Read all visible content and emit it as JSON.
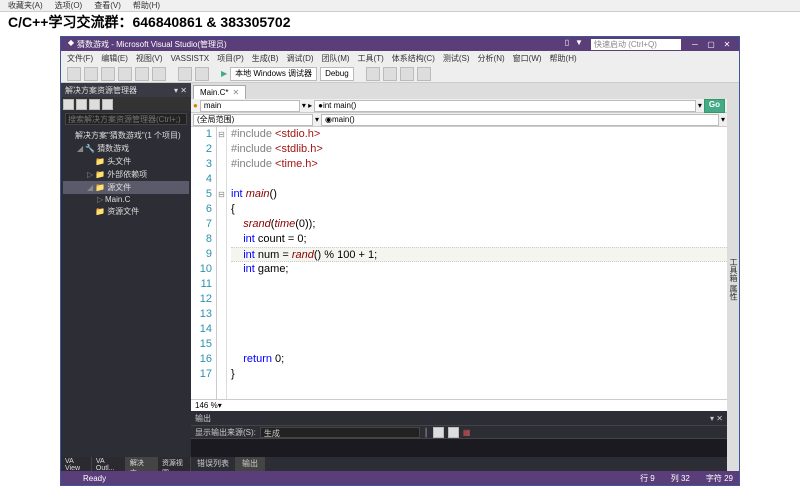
{
  "browser_menu": [
    "收藏夹(A)",
    "选项(O)",
    "查看(V)",
    "帮助(H)"
  ],
  "banner": "C/C++学习交流群：646840861 & 383305702",
  "title": "猜数游戏 - Microsoft Visual Studio(管理员)",
  "quick_launch": "快速启动 (Ctrl+Q)",
  "main_menu": [
    "文件(F)",
    "编辑(E)",
    "视图(V)",
    "VASSISTX",
    "项目(P)",
    "生成(B)",
    "调试(D)",
    "团队(M)",
    "工具(T)",
    "体系结构(C)",
    "测试(S)",
    "分析(N)",
    "窗口(W)",
    "帮助(H)"
  ],
  "toolbar": {
    "debugger": "本地 Windows 调试器",
    "config": "Debug"
  },
  "solution_panel": {
    "title": "解决方案资源管理器",
    "search_ph": "搜索解决方案资源管理器(Ctrl+;)",
    "root": "解决方案\"猜数游戏\"(1 个项目)",
    "project": "猜数游戏",
    "folders": [
      "头文件",
      "外部依赖项",
      "源文件",
      "资源文件"
    ],
    "file": "Main.C",
    "bottom_tabs": [
      "VA View",
      "VA Outl...",
      "解决方...",
      "资源视图"
    ]
  },
  "editor": {
    "tab": "Main.C*",
    "nav_l": "main",
    "nav_r": "int main()",
    "nav_b": "main()",
    "scope": "(全局范围)",
    "zoom": "146 %",
    "go": "Go",
    "lines": [
      {
        "n": 1,
        "seg": [
          [
            "pp",
            "#include "
          ],
          [
            "inc",
            "<stdio.h>"
          ]
        ]
      },
      {
        "n": 2,
        "seg": [
          [
            "pp",
            "#include "
          ],
          [
            "inc",
            "<stdlib.h>"
          ]
        ]
      },
      {
        "n": 3,
        "seg": [
          [
            "pp",
            "#include "
          ],
          [
            "inc",
            "<time.h>"
          ]
        ]
      },
      {
        "n": 4,
        "seg": []
      },
      {
        "n": 5,
        "seg": [
          [
            "kw",
            "int"
          ],
          [
            "",
            " "
          ],
          [
            "fn",
            "main"
          ],
          [
            "",
            "()"
          ]
        ]
      },
      {
        "n": 6,
        "seg": [
          [
            "",
            "{"
          ]
        ]
      },
      {
        "n": 7,
        "seg": [
          [
            "",
            "    "
          ],
          [
            "fn",
            "srand"
          ],
          [
            "",
            "("
          ],
          [
            "fn",
            "time"
          ],
          [
            "",
            "(0));"
          ]
        ]
      },
      {
        "n": 8,
        "seg": [
          [
            "",
            "    "
          ],
          [
            "kw",
            "int"
          ],
          [
            "",
            " count = 0;"
          ]
        ]
      },
      {
        "n": 9,
        "cur": true,
        "seg": [
          [
            "",
            "    "
          ],
          [
            "kw",
            "int"
          ],
          [
            "",
            " num = "
          ],
          [
            "fn",
            "rand"
          ],
          [
            "",
            "() % 100 + 1;"
          ]
        ]
      },
      {
        "n": 10,
        "seg": [
          [
            "",
            "    "
          ],
          [
            "kw",
            "int"
          ],
          [
            "",
            " game;"
          ]
        ]
      },
      {
        "n": 11,
        "seg": []
      },
      {
        "n": 12,
        "seg": []
      },
      {
        "n": 13,
        "seg": []
      },
      {
        "n": 14,
        "seg": []
      },
      {
        "n": 15,
        "seg": []
      },
      {
        "n": 16,
        "seg": [
          [
            "",
            "    "
          ],
          [
            "kw",
            "return"
          ],
          [
            "",
            " 0;"
          ]
        ]
      },
      {
        "n": 17,
        "seg": [
          [
            "",
            "}"
          ]
        ]
      }
    ]
  },
  "output": {
    "title": "输出",
    "source_label": "显示输出来源(S):",
    "source": "生成",
    "tabs": [
      "错误列表",
      "输出"
    ]
  },
  "status": {
    "ready": "Ready",
    "line": "行 9",
    "col": "列 32",
    "char": "字符 29"
  },
  "side_tabs": [
    "工具箱",
    "属性"
  ]
}
